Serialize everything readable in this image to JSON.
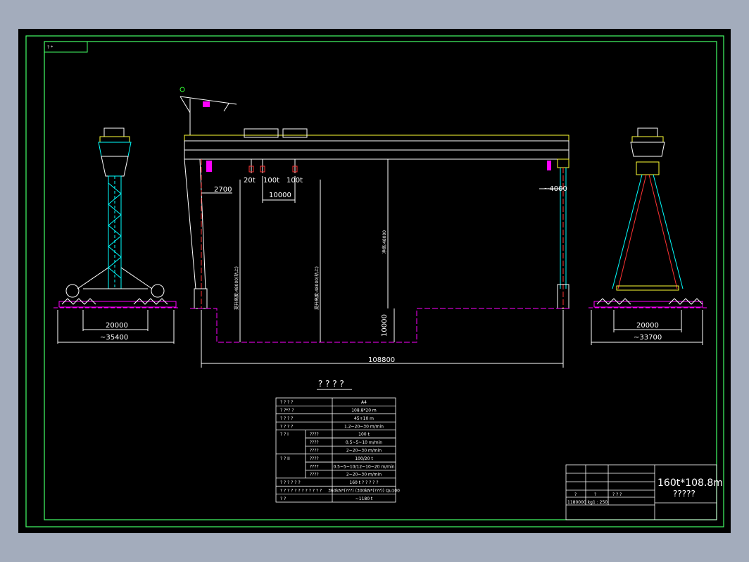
{
  "drawing": {
    "frame_tag": "? *",
    "colors": {
      "background": "#000000",
      "window": "#a3acbc",
      "border": "#44ff66",
      "structure": "#ffffff",
      "cyan": "#00ffff",
      "yellow": "#ffff33",
      "magenta": "#ff00ff",
      "red": "#ff3333",
      "green": "#33ff33"
    },
    "dimensions": {
      "left_inner": "20000",
      "left_outer": "~35400",
      "hook_offset_left": "2700",
      "trolley_spacing": "10000",
      "hook_offset_right": "~4000",
      "pit_depth": "10000",
      "span": "108800",
      "right_inner": "20000",
      "right_outer": "~33700"
    },
    "hook_labels": [
      "20t",
      "100t",
      "100t"
    ],
    "vertical_labels": {
      "lift_a": "提升高度:48000(轨上)",
      "lift_b": "提升高度:48000(轨上)",
      "clear": "净高:48000"
    },
    "table": {
      "title": "? ? ? ?",
      "rows": [
        {
          "group": "? ? ? ?",
          "sub": "",
          "value": "A4"
        },
        {
          "group": "? ?*? ?",
          "sub": "",
          "value": "108.8*20   m"
        },
        {
          "group": "? ? ? ?",
          "sub": "",
          "value": "45+10   m"
        },
        {
          "group": "? ? ? ?",
          "sub": "",
          "value": "1.2~20~30   m/min"
        },
        {
          "group": "? ? I",
          "sub": "????",
          "value": "100   t"
        },
        {
          "group": "",
          "sub": "????",
          "value": "0.5~5~10   m/min"
        },
        {
          "group": "",
          "sub": "????",
          "value": "2~20~30   m/min"
        },
        {
          "group": "? ? II",
          "sub": "????",
          "value": "100/20   t"
        },
        {
          "group": "",
          "sub": "????",
          "value": "0.5~5~10/12~10~20  m/min"
        },
        {
          "group": "",
          "sub": "????",
          "value": "2~20~30   m/min"
        },
        {
          "group": "? ? ? ? ? ?",
          "sub": "",
          "value": "160    t  ? ? ? ? ?"
        },
        {
          "group": "? ? ? ? ? ? ? ? ? ? ? ?",
          "sub": "",
          "value": "360kN*(???)  (300kN*(???))  Qu100"
        },
        {
          "group": "?     ?",
          "sub": "",
          "value": "~1180   t"
        }
      ]
    },
    "title_block": {
      "line1": "160t*108.8m",
      "line2": "?????",
      "scale": "1 : 250",
      "weight": "1180000 kg",
      "small1": "?",
      "small2": "?",
      "small3": "? ? ?"
    }
  }
}
